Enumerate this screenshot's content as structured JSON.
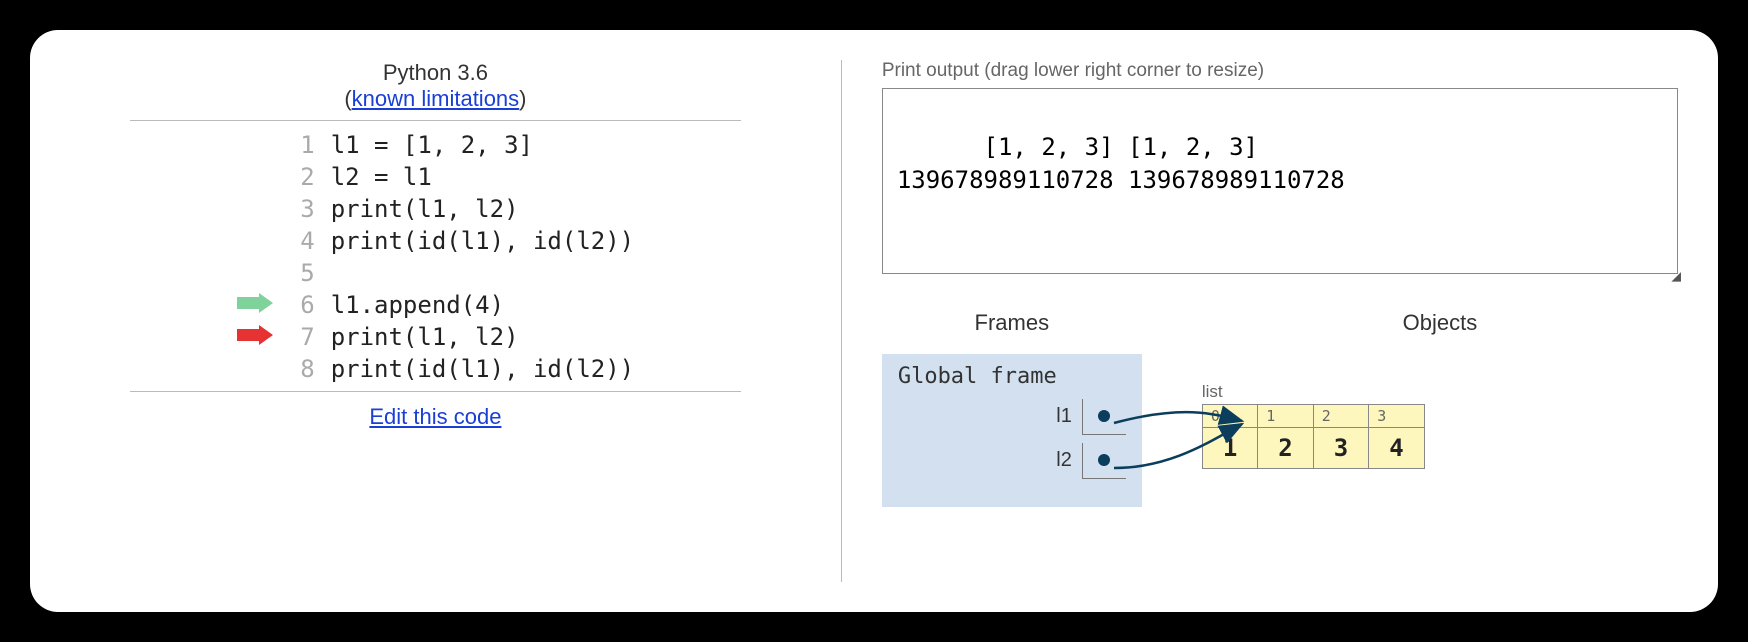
{
  "header": {
    "language": "Python 3.6",
    "limitations_label": "known limitations",
    "edit_link": "Edit this code"
  },
  "code": {
    "lines": [
      "l1 = [1, 2, 3]",
      "l2 = l1",
      "print(l1, l2)",
      "print(id(l1), id(l2))",
      "",
      "l1.append(4)",
      "print(l1, l2)",
      "print(id(l1), id(l2))"
    ],
    "prev_arrow_line": 6,
    "next_arrow_line": 7
  },
  "output": {
    "label": "Print output (drag lower right corner to resize)",
    "text": "[1, 2, 3] [1, 2, 3]\n139678989110728 139678989110728"
  },
  "viz": {
    "frames_label": "Frames",
    "objects_label": "Objects",
    "global_frame_label": "Global frame",
    "variables": [
      {
        "name": "l1"
      },
      {
        "name": "l2"
      }
    ],
    "list_label": "list",
    "list": {
      "indices": [
        "0",
        "1",
        "2",
        "3"
      ],
      "values": [
        "1",
        "2",
        "3",
        "4"
      ]
    }
  },
  "colors": {
    "prev_arrow": "#7fd39a",
    "next_arrow": "#e63232",
    "pointer": "#0b3d5c"
  }
}
